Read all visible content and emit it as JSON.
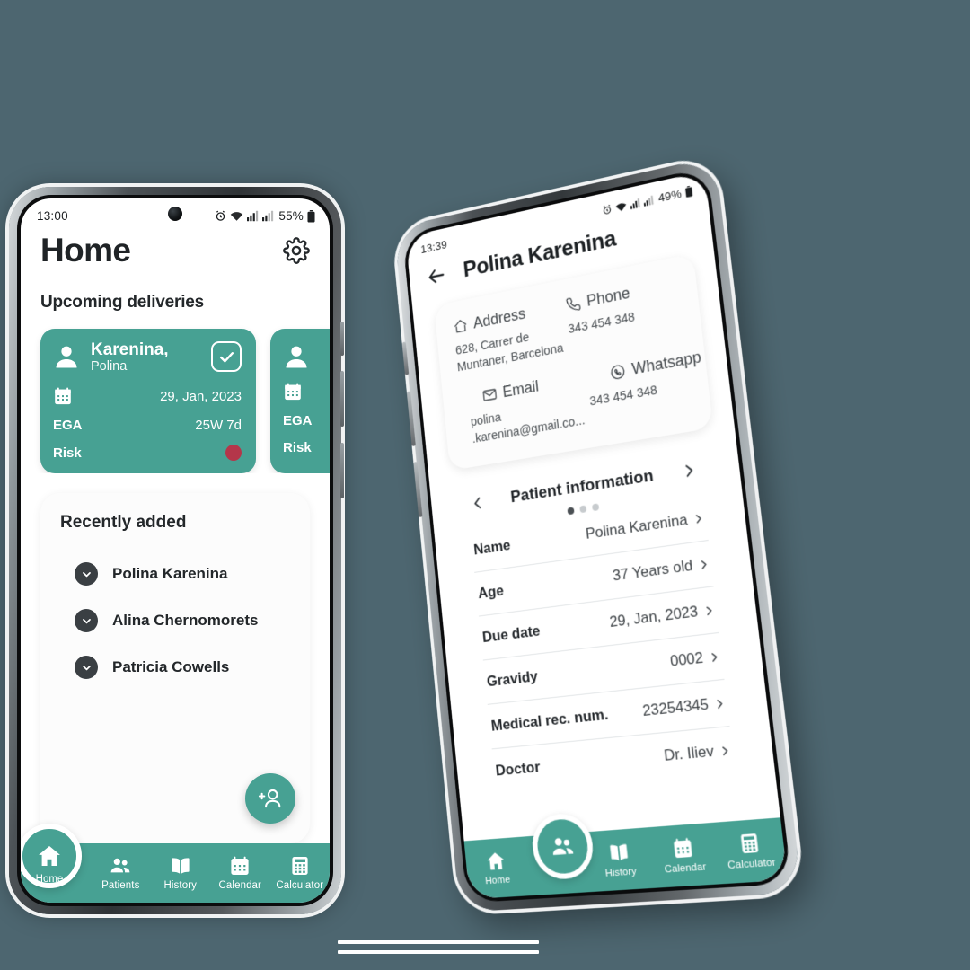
{
  "theme": {
    "background": "#4d6670",
    "accent": "#47a193",
    "risk_color": "#b4364a",
    "text_dark": "#22262a"
  },
  "phone_left": {
    "status_bar": {
      "time": "13:00",
      "battery_percent": "55%",
      "icons": [
        "alarm-icon",
        "wifi-icon",
        "signal-icon",
        "signal-icon",
        "battery-icon"
      ]
    },
    "header": {
      "title": "Home",
      "settings_icon": "gear-icon"
    },
    "upcoming": {
      "section_title": "Upcoming deliveries",
      "cards": [
        {
          "last_name": "Karenina,",
          "first_name": "Polina",
          "date": "29, Jan, 2023",
          "ega_label": "EGA",
          "ega_value": "25W 7d",
          "risk_label": "Risk",
          "checked": true
        },
        {
          "last_name": "",
          "first_name": "",
          "date": "",
          "ega_label": "EGA",
          "ega_value": "",
          "risk_label": "Risk",
          "checked": false
        }
      ]
    },
    "recently_added": {
      "title": "Recently added",
      "items": [
        {
          "name": "Polina Karenina"
        },
        {
          "name": "Alina Chernomorets"
        },
        {
          "name": "Patricia Cowells"
        }
      ]
    },
    "fab": {
      "icon": "add-person-icon"
    },
    "nav": {
      "active": "Home",
      "items": [
        {
          "label": "Home",
          "icon": "home-icon"
        },
        {
          "label": "Patients",
          "icon": "people-icon"
        },
        {
          "label": "History",
          "icon": "book-icon"
        },
        {
          "label": "Calendar",
          "icon": "calendar-icon"
        },
        {
          "label": "Calculator",
          "icon": "calculator-icon"
        }
      ]
    }
  },
  "phone_right": {
    "status_bar": {
      "time": "13:39",
      "battery_percent": "49%",
      "icons": [
        "alarm-icon",
        "wifi-icon",
        "signal-icon",
        "signal-icon",
        "battery-icon"
      ]
    },
    "header": {
      "title": "Polina Karenina",
      "back_icon": "back-arrow-icon"
    },
    "contact": {
      "address_label": "Address",
      "address_value": "628, Carrer de Muntaner, Barcelona",
      "phone_label": "Phone",
      "phone_value": "343 454 348",
      "email_label": "Email",
      "email_value": "polina .karenina@gmail.co...",
      "whatsapp_label": "Whatsapp",
      "whatsapp_value": "343 454 348"
    },
    "patient_information": {
      "title": "Patient information",
      "page_dots": 3,
      "active_dot": 0,
      "rows": [
        {
          "label": "Name",
          "value": "Polina Karenina"
        },
        {
          "label": "Age",
          "value": "37 Years old"
        },
        {
          "label": "Due date",
          "value": "29, Jan, 2023"
        },
        {
          "label": "Gravidy",
          "value": "0002"
        },
        {
          "label": "Medical rec. num.",
          "value": "23254345"
        },
        {
          "label": "Doctor",
          "value": "Dr. Iliev"
        }
      ]
    },
    "nav": {
      "active": "Patients",
      "items": [
        {
          "label": "Home",
          "icon": "home-icon"
        },
        {
          "label": "Patients",
          "icon": "people-icon"
        },
        {
          "label": "History",
          "icon": "book-icon"
        },
        {
          "label": "Calendar",
          "icon": "calendar-icon"
        },
        {
          "label": "Calculator",
          "icon": "calculator-icon"
        }
      ]
    }
  }
}
